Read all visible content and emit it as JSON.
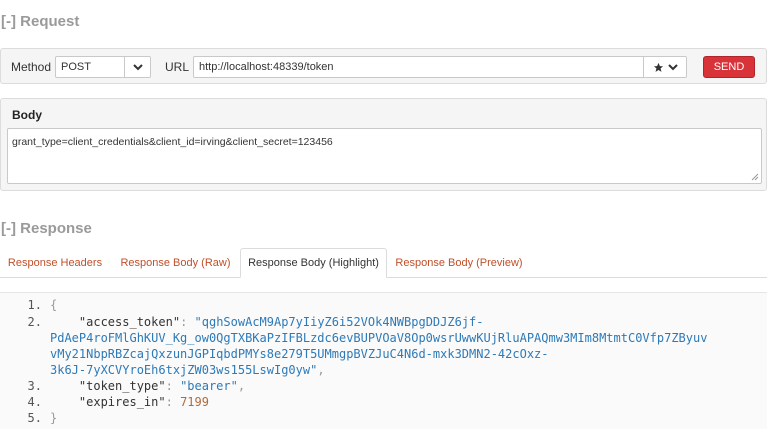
{
  "request": {
    "title": "[-] Request",
    "method_label": "Method",
    "method_value": "POST",
    "url_label": "URL",
    "url_value": "http://localhost:48339/token",
    "send_label": "SEND",
    "body_title": "Body",
    "body_value": "grant_type=client_credentials&client_id=irving&client_secret=123456"
  },
  "response": {
    "title": "[-] Response",
    "tabs": [
      {
        "label": "Response Headers"
      },
      {
        "label": "Response Body (Raw)"
      },
      {
        "label": "Response Body (Highlight)",
        "active": true
      },
      {
        "label": "Response Body (Preview)"
      }
    ],
    "line_numbers": [
      "1.",
      "2.",
      "3.",
      "4.",
      "5."
    ],
    "json": {
      "open_brace": "{",
      "close_brace": "}",
      "access_token_key": "\"access_token\"",
      "access_token_lines": [
        "\"qghSowAcM9Ap7yIiyZ6i52VOk4NWBpgDDJZ6jf-",
        "PdAeP4roFMlGhKUV_Kg_ow0QgTXBKaPzIFBLzdc6evBUPVOaV8Op0wsrUwwKUjRluAPAQmw3MIm8MtmtC0Vfp7ZByuv",
        "vMy21NbpRBZcajQxzunJGPIqbdPMYs8e279T5UMmgpBVZJuC4N6d-mxk3DMN2-42cOxz-",
        "3k6J-7yXCVYroEh6txjZW03ws155LswIg0yw\""
      ],
      "token_type_key": "\"token_type\"",
      "token_type_value": "\"bearer\"",
      "expires_in_key": "\"expires_in\"",
      "expires_in_value": "7199"
    }
  },
  "colors": {
    "send_button": "#d9333a",
    "tab_link": "#c0502a",
    "json_string": "#2d7ab8",
    "json_number": "#b26a39"
  },
  "icons": {
    "method_dropdown": "chevron-down-icon",
    "url_favorite": "star-icon",
    "url_dropdown": "chevron-down-icon",
    "body_resize": "resize-grip-icon"
  }
}
